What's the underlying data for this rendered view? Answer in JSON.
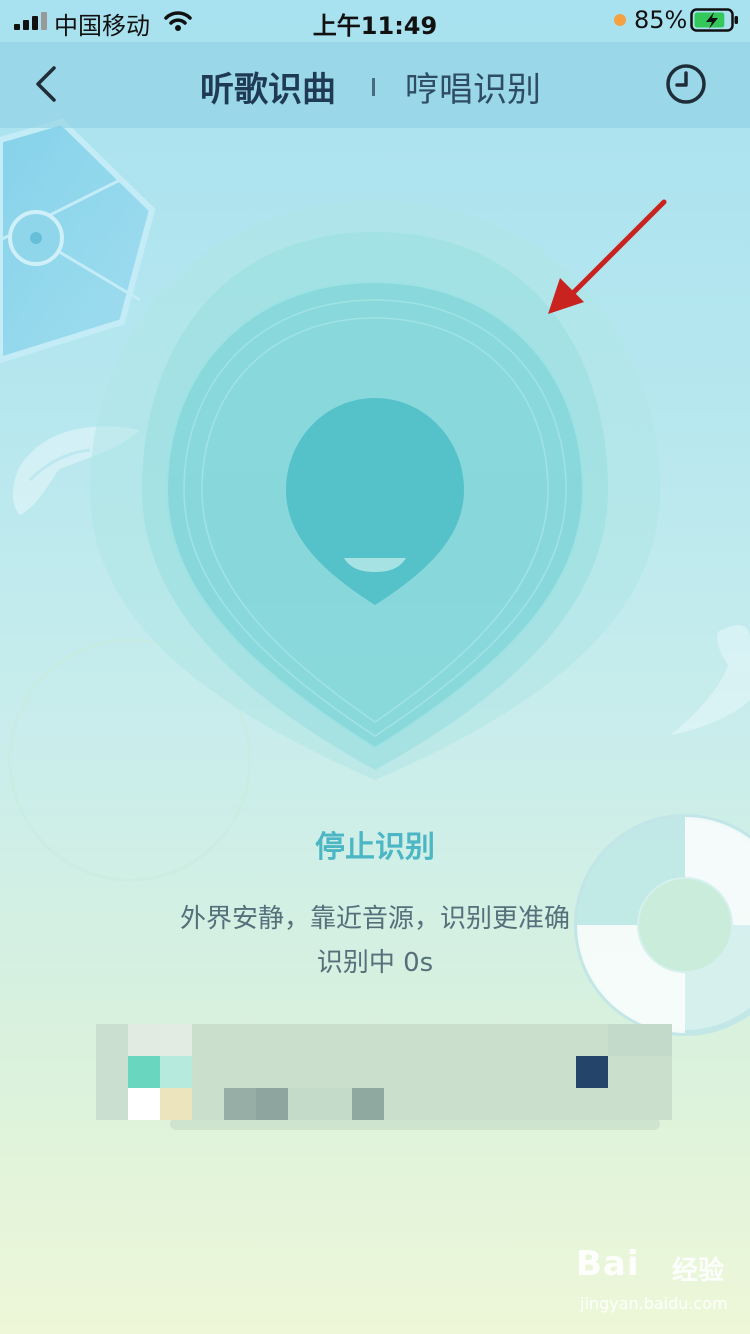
{
  "status_bar": {
    "carrier": "中国移动",
    "time": "上午11:49",
    "battery_percent": "85%",
    "battery_level": 0.85,
    "icons": [
      "signal-icon",
      "wifi-icon",
      "battery-charging-icon"
    ]
  },
  "nav": {
    "back_icon": "chevron-left-icon",
    "tab_active": "听歌识曲",
    "tab_inactive": "哼唱识别",
    "history_icon": "clock-icon"
  },
  "recognizer": {
    "stop_label": "停止识别",
    "hint": "外界安静，靠近音源，识别更准确",
    "counter": "识别中 0s"
  },
  "watermark": {
    "logo": "Bai",
    "logo_cn": "经验",
    "url": "jingyan.baidu.com"
  },
  "colors": {
    "accent": "#4cb6c4",
    "annotation_arrow": "#c8231f",
    "title": "#1f3a55"
  }
}
